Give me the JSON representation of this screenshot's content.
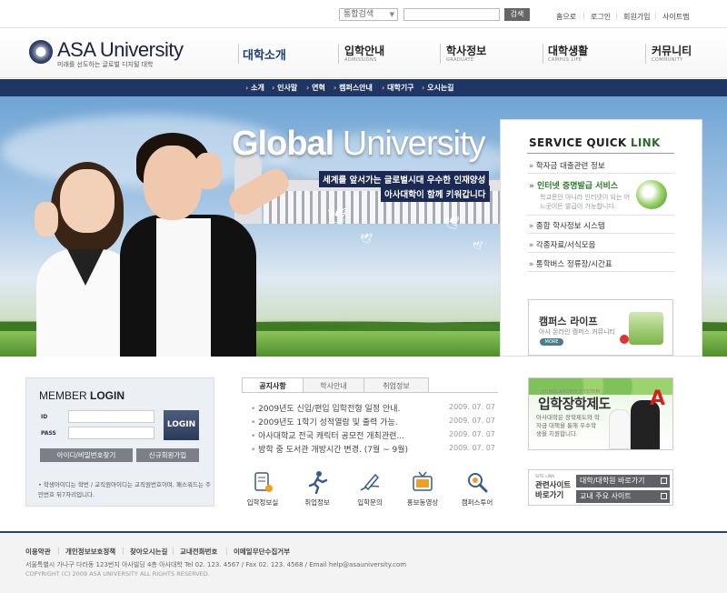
{
  "top": {
    "search_select": "통합검색",
    "search_button": "검색",
    "util_links": [
      "홈으로",
      "로그인",
      "회원가입",
      "사이트맵"
    ]
  },
  "logo": {
    "name": "ASA University",
    "tagline": "미래를 선도하는 글로벌 디지털 대학"
  },
  "gnb": [
    {
      "ko": "대학소개",
      "en": ""
    },
    {
      "ko": "입학안내",
      "en": "ADMISSIONS"
    },
    {
      "ko": "학사정보",
      "en": "GRADUATE"
    },
    {
      "ko": "대학생활",
      "en": "CAMPUS LIFE"
    },
    {
      "ko": "커뮤니티",
      "en": "COMMUNITY"
    }
  ],
  "subnav": [
    "소개",
    "인사말",
    "연혁",
    "캠퍼스안내",
    "대학기구",
    "오시는길"
  ],
  "hero": {
    "title_bold": "Global",
    "title_rest": " University",
    "copy_line1": "세계를 앞서가는 글로벌시대 우수한 인재양성",
    "copy_line2": "아사대학이 함께 키워갑니다"
  },
  "quick_link": {
    "title_a": "SERVICE QUICK ",
    "title_b": "LINK",
    "items": [
      "학자금 대출관련 정보",
      "인터넷 증명발급 서비스",
      "종합 학사정보 시스템",
      "각종자료/서식모음",
      "통학버스 정류장/시간표"
    ],
    "item2_desc": "학교문안 아니라 인터넷이 되는 어느곳이든 발급이 가능합니다."
  },
  "campus_life": {
    "title": "캠퍼스 라이프",
    "subtitle": "아사 온라인 캠퍼스 커뮤니티",
    "more": "MORE"
  },
  "login": {
    "title_a": "MEMBER ",
    "title_b": "LOGIN",
    "id_label": "ID",
    "pass_label": "PASS",
    "button": "LOGIN",
    "find_button": "아이디/비밀번호찾기",
    "join_button": "신규회원가입",
    "note": "• 학생아이디는 학번 / 교직원아이디는 교직원번호이며, 패스워드는 주민번호 뒤7자리입니다."
  },
  "tabs": [
    "공지사항",
    "학사안내",
    "취업정보"
  ],
  "notices": [
    {
      "title": "2009년도 신입/편입 입학전형 일정 안내.",
      "date": "2009. 07. 07"
    },
    {
      "title": "2009년도 1학기 성적열람 및 출력 가능.",
      "date": "2009. 07. 07"
    },
    {
      "title": "아사대학교 전국 캐릭터 공모전 개최관련...",
      "date": "2009. 07. 07"
    },
    {
      "title": "방학 중 도서관 개방시간 변경. (7월 ~ 9월)",
      "date": "2009. 07. 07"
    }
  ],
  "quick_icons": [
    {
      "label": "입학정보실",
      "icon": "book-icon"
    },
    {
      "label": "취업정보",
      "icon": "runner-icon"
    },
    {
      "label": "입학문의",
      "icon": "pen-icon"
    },
    {
      "label": "홍보동영상",
      "icon": "tv-icon"
    },
    {
      "label": "캠퍼스투어",
      "icon": "magnifier-icon"
    }
  ],
  "scholarship": {
    "en": "SCHOLARSHIP SYSTEM",
    "title": "입학장학제도",
    "desc": "아사대학은 장학제도와 학자금 대책을 통해 우수학생을 지원합니다."
  },
  "site_link": {
    "en": "SITE LINK",
    "title": "관련사이트 바로가기",
    "buttons": [
      "대학/대학원 바로가기",
      "교내 주요 사이트"
    ]
  },
  "footer": {
    "links": [
      "이용약관",
      "개인정보보호정책",
      "찾아오시는길",
      "교내전화번호",
      "이메일무단수집거부"
    ],
    "address": "서울특별시 가나구 다라동 123번지 아사빌딩 4층 아사대학    Tel  02. 123. 4567 / Fax  02. 123. 4568 / Email  help@asauniversity.com",
    "copyright": "COPYRIGHT (C) 2009 ASA UNIVERSITY ALL RIGHTS RESERVED."
  },
  "colors": {
    "navy": "#1f3566",
    "green": "#2d7a2d",
    "accent_red": "#d62020"
  }
}
